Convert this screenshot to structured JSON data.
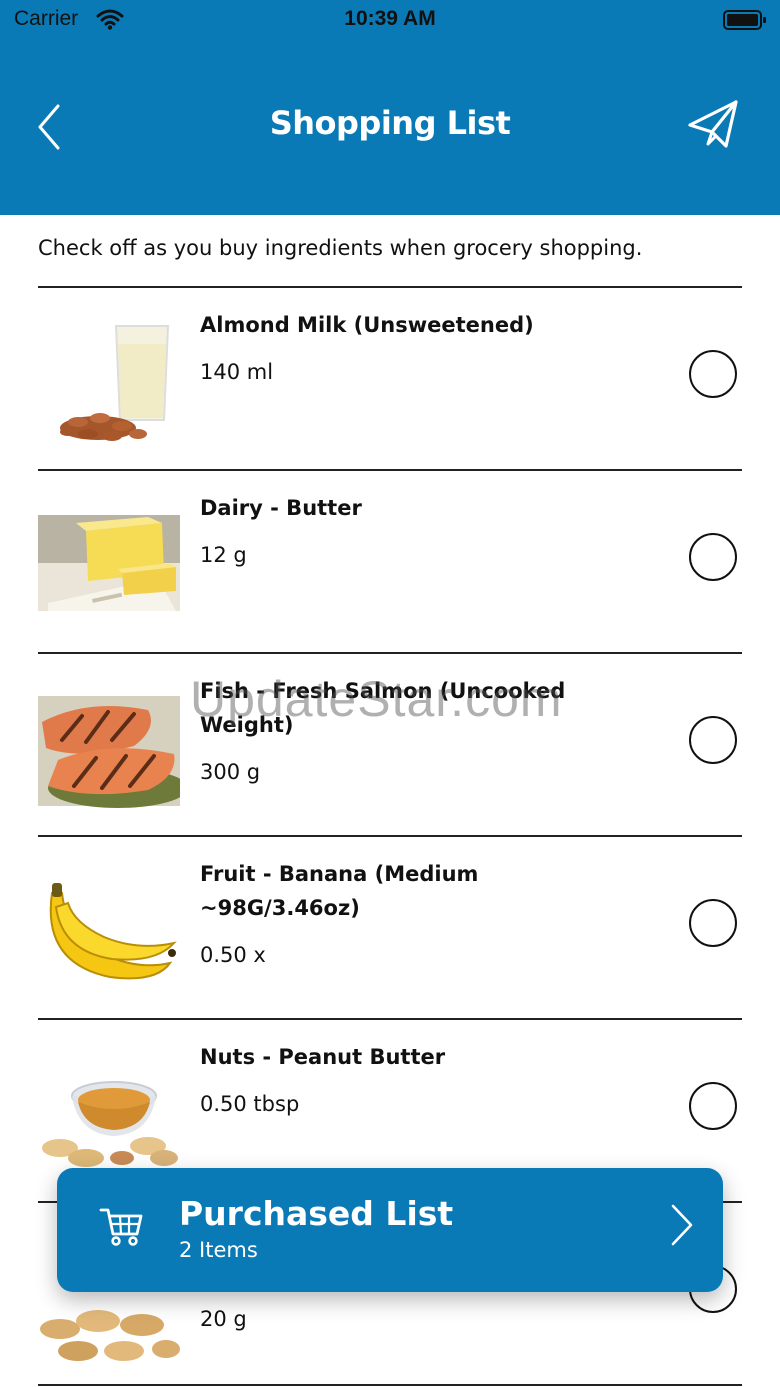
{
  "status_bar": {
    "carrier": "Carrier",
    "time": "10:39 AM"
  },
  "header": {
    "title": "Shopping List"
  },
  "intro": "Check off as you buy ingredients when grocery shopping.",
  "items": [
    {
      "name": "Almond Milk (Unsweetened)",
      "quantity": "140 ml",
      "icon": "almond-milk-image",
      "checked": false
    },
    {
      "name": "Dairy - Butter",
      "quantity": "12 g",
      "icon": "butter-image",
      "checked": false
    },
    {
      "name": "Fish - Fresh Salmon (Uncooked Weight)",
      "quantity": "300 g",
      "icon": "salmon-image",
      "checked": false
    },
    {
      "name": "Fruit - Banana (Medium ~98G/3.46oz)",
      "quantity": "0.50 x",
      "icon": "banana-image",
      "checked": false
    },
    {
      "name": "Nuts - Peanut Butter",
      "quantity": "0.50 tbsp",
      "icon": "peanut-butter-image",
      "checked": false
    },
    {
      "name": "",
      "quantity": "20 g",
      "icon": "peanuts-image",
      "checked": false
    }
  ],
  "watermark": "UpdateStar.com",
  "purchased": {
    "title": "Purchased List",
    "count": "2 Items"
  },
  "colors": {
    "brand": "#0a7ab7",
    "divider": "#222222"
  }
}
